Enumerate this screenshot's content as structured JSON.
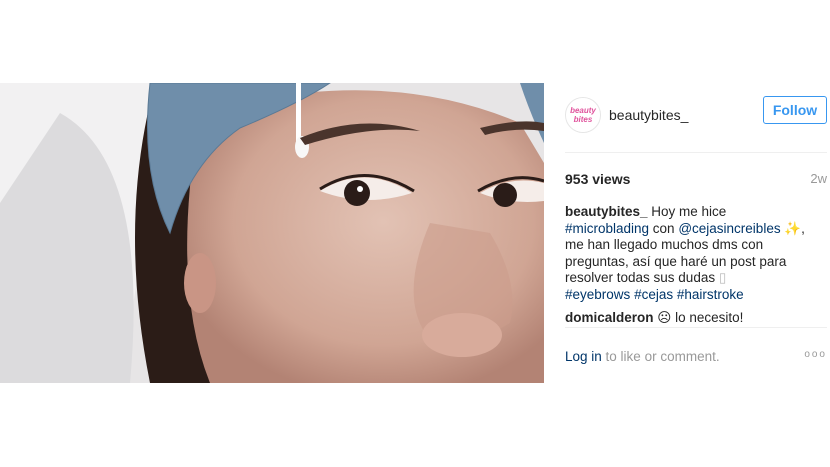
{
  "post": {
    "username": "beautybites_",
    "follow_label": "Follow",
    "views": "953 views",
    "time": "2w",
    "caption": {
      "username": "beautybites_",
      "line1": " Hoy me hice",
      "tag1": "#microblading",
      "con": " con ",
      "mention": "@cejasincreibles",
      "sparkle": " ✨,",
      "rest": " me han llegado muchos dms con preguntas, así que haré un post para resolver todas sus dudas ",
      "box": "▯",
      "tag2": "#eyebrows",
      "tag3": "#cejas",
      "tag4": "#hairstroke"
    },
    "comment": {
      "username": "domicalderon",
      "emoji": "☹",
      "text": "lo necesito!"
    },
    "login_link": "Log in",
    "login_rest": " to like or comment.",
    "more": "ooo"
  },
  "icons": [
    "avatar-logo",
    "more-options-icon"
  ],
  "colors": {
    "accent": "#3897f0",
    "link": "#003569",
    "muted": "#999999"
  }
}
